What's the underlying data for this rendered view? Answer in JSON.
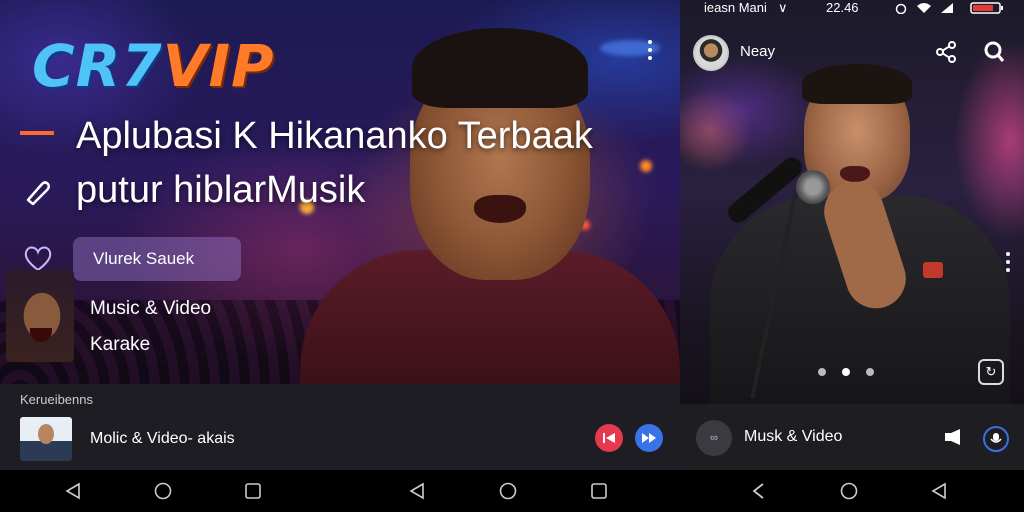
{
  "left_panel": {
    "logo": {
      "part1": "CR7",
      "part2": "VIP"
    },
    "headline_line1": "Aplubasi K Hikananko Terbaak",
    "headline_line2": "putur hiblarMusik",
    "pill_label": "Vlurek Sauek",
    "menu_item_1": "Music & Video",
    "menu_item_2": "Karake",
    "section_label": "Kerueibenns",
    "now_playing_title": "Molic & Video- akais",
    "colors": {
      "logo_cyan": "#4fc3f7",
      "logo_orange": "#ff7a29",
      "accent_dash": "#ff6a2b",
      "prev_btn": "#e53950",
      "next_btn": "#3a72e8"
    }
  },
  "right_panel": {
    "status": {
      "carrier": "ieasn Mani",
      "clock": "22.46"
    },
    "user_name": "Neay",
    "now_playing_title": "Musk & Video",
    "disc_label": "∞"
  },
  "icons": {
    "share": "share-icon",
    "search": "search-icon",
    "heart": "heart-icon",
    "pen": "pen-icon"
  }
}
